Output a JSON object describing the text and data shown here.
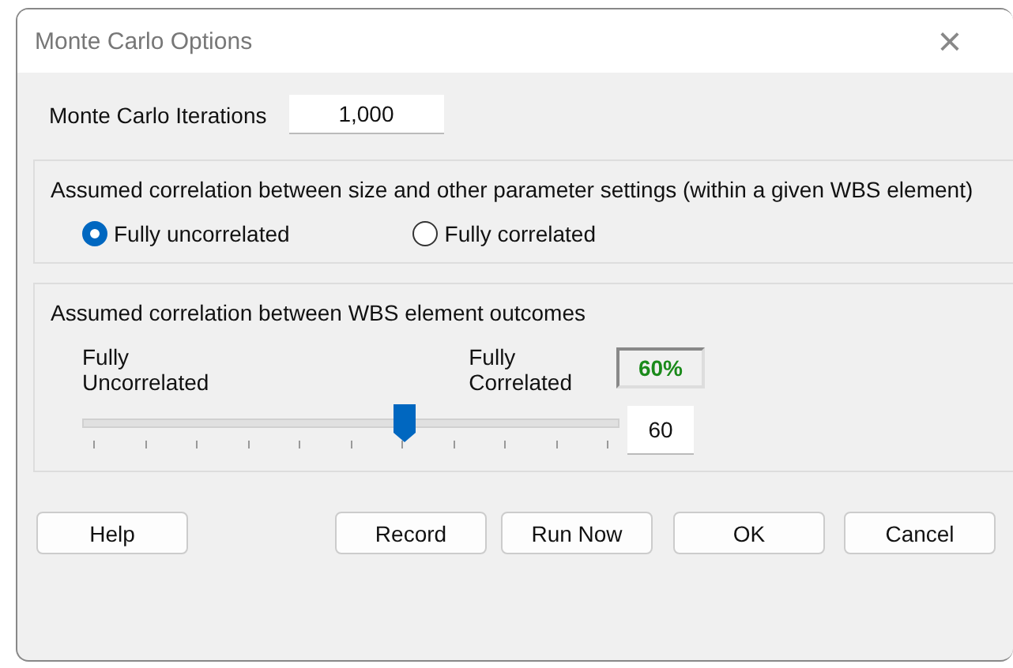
{
  "window": {
    "title": "Monte Carlo Options",
    "close": "×"
  },
  "iterations": {
    "label": "Monte Carlo Iterations",
    "value": "1,000"
  },
  "size_group": {
    "title": "Assumed correlation between size and other parameter settings (within a given WBS element)",
    "options": [
      {
        "label": "Fully uncorrelated",
        "selected": true
      },
      {
        "label": "Fully correlated",
        "selected": false
      }
    ]
  },
  "wbs_group": {
    "title": "Assumed correlation between WBS element outcomes",
    "left_label": "Fully\nUncorrelated",
    "right_label": "Fully\nCorrelated",
    "percent": "60%",
    "level": 0.6,
    "value": "60"
  },
  "buttons": [
    "Help",
    "Record",
    "Run Now",
    "OK",
    "Cancel"
  ]
}
